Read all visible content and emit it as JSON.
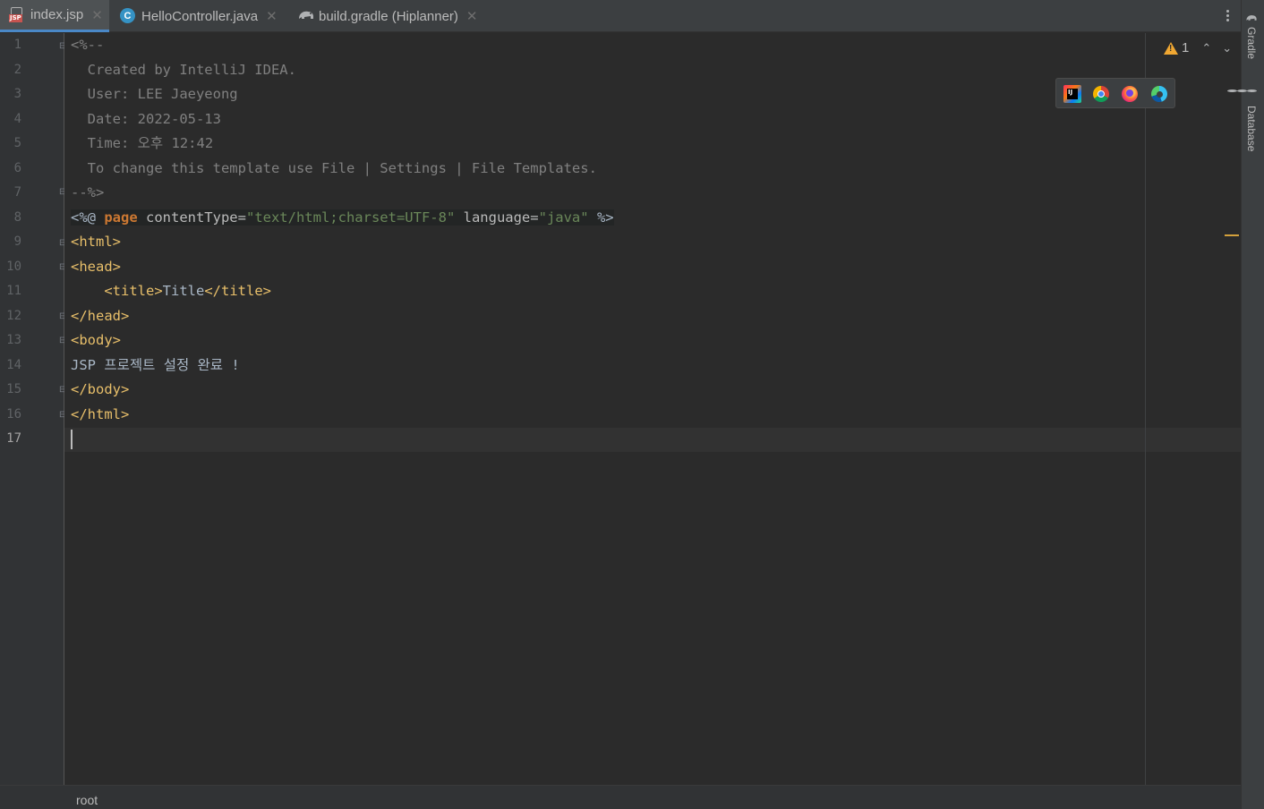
{
  "tabs": [
    {
      "label": "index.jsp",
      "icon": "jsp-file-icon",
      "badge": "JSP",
      "active": true
    },
    {
      "label": "HelloController.java",
      "icon": "java-class-icon",
      "badge": "C",
      "active": false
    },
    {
      "label": "build.gradle (Hiplanner)",
      "icon": "gradle-elephant-icon",
      "active": false
    }
  ],
  "gutter": {
    "line_numbers": [
      "1",
      "2",
      "3",
      "4",
      "5",
      "6",
      "7",
      "8",
      "9",
      "10",
      "11",
      "12",
      "13",
      "14",
      "15",
      "16",
      "17"
    ],
    "current_line": "17"
  },
  "code": {
    "l1": "<%--",
    "l2": "  Created by IntelliJ IDEA.",
    "l3": "  User: LEE Jaeyeong",
    "l4": "  Date: 2022-05-13",
    "l5": "  Time: 오후 12:42",
    "l6": "  To change this template use File | Settings | File Templates.",
    "l7": "--%>",
    "l8": {
      "open": "<%@ ",
      "kw": "page",
      "attr1": " contentType=",
      "val1": "\"text/html;charset=UTF-8\"",
      "attr2": " language=",
      "val2": "\"java\"",
      "close": " %>"
    },
    "l9": "<html>",
    "l10": "<head>",
    "l11": {
      "indent": "    ",
      "open": "<title>",
      "text": "Title",
      "close": "</title>"
    },
    "l12": "</head>",
    "l13": "<body>",
    "l14": "JSP 프로젝트 설정 완료 !",
    "l15": "</body>",
    "l16": "</html>",
    "l17": ""
  },
  "inspections": {
    "warning_count": "1",
    "warning_glyph": "!"
  },
  "browser_popup": [
    {
      "name": "IntelliJ built-in preview",
      "icon": "intellij-icon",
      "glyph": "IJ"
    },
    {
      "name": "Chrome",
      "icon": "chrome-icon"
    },
    {
      "name": "Firefox",
      "icon": "firefox-icon"
    },
    {
      "name": "Edge",
      "icon": "edge-icon"
    }
  ],
  "right_tools": [
    {
      "label": "Gradle",
      "icon": "gradle-icon"
    },
    {
      "label": "Database",
      "icon": "database-icon"
    }
  ],
  "breadcrumb": {
    "root": "root"
  },
  "colors": {
    "background": "#2b2b2b",
    "tag": "#e8bf6a",
    "comment": "#808080",
    "string": "#6a8759",
    "keyword": "#cc7832",
    "warning": "#f0a732"
  }
}
